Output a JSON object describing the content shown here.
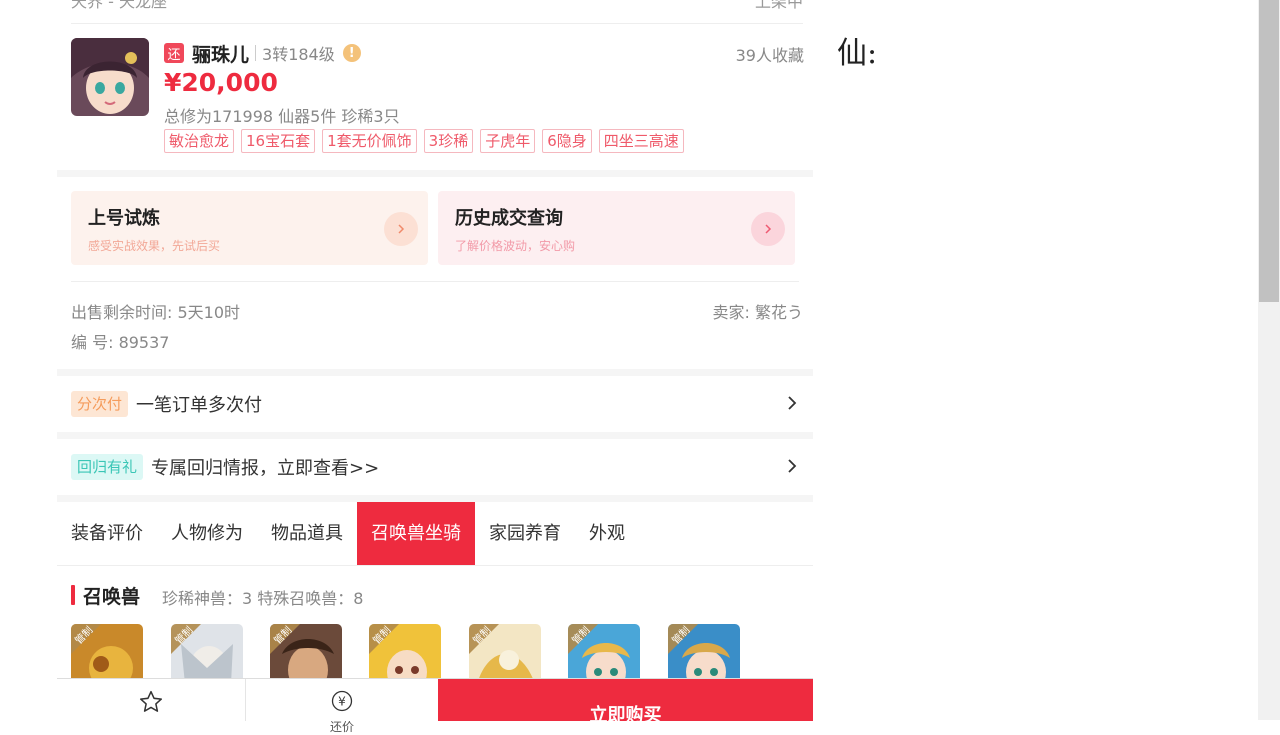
{
  "header": {
    "left_text": "天界 - 天龙座",
    "right_text": "上架中"
  },
  "product": {
    "return_badge": "还",
    "name": "骊珠儿",
    "level": "3转184级",
    "warn_icon": "!",
    "favorites": "39人收藏",
    "price": "¥20,000",
    "stats": "总修为171998  仙器5件  珍稀3只",
    "tags": [
      "敏治愈龙",
      "16宝石套",
      "1套无价佩饰",
      "3珍稀",
      "子虎年",
      "6隐身",
      "四坐三高速"
    ]
  },
  "actions": [
    {
      "title": "上号试炼",
      "subtitle": "感受实战效果，先试后买"
    },
    {
      "title": "历史成交查询",
      "subtitle": "了解价格波动，安心购"
    }
  ],
  "info": {
    "remaining": "出售剩余时间: 5天10时",
    "seller": "卖家: 繁花う",
    "serial": "编 号: 89537"
  },
  "rows": [
    {
      "badge": "分次付",
      "text": "一笔订单多次付"
    },
    {
      "badge": "回归有礼",
      "text": "专属回归情报，立即查看>>"
    }
  ],
  "tabs": [
    "装备评价",
    "人物修为",
    "物品道具",
    "召唤兽坐骑",
    "家园养育",
    "外观"
  ],
  "active_tab": "召唤兽坐骑",
  "pets_section": {
    "title": "召唤兽",
    "meta": "珍稀神兽：3   特殊召唤兽：8",
    "corner_label": "管制"
  },
  "bottom_bar": {
    "bargain_label": "还价",
    "buy_label": "立即购买",
    "bargain_icon": "¥"
  },
  "side_text": "仙:",
  "colors": {
    "accent": "#ee2b3f",
    "muted": "#888888"
  }
}
